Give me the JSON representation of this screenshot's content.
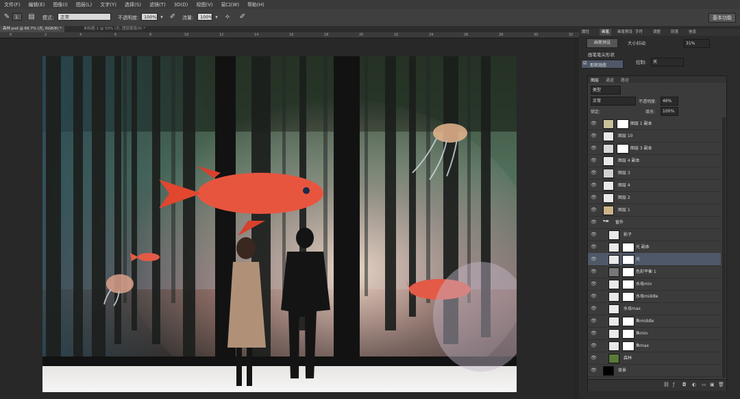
{
  "menubar": [
    "文件(F)",
    "编辑(E)",
    "图像(I)",
    "图层(L)",
    "文字(Y)",
    "选择(S)",
    "滤镜(T)",
    "3D(D)",
    "视图(V)",
    "窗口(W)",
    "帮助(H)"
  ],
  "options": {
    "mode_label": "模式:",
    "mode_value": "正常",
    "opacity_label": "不透明度:",
    "opacity_value": "100%",
    "flow_label": "流量:",
    "flow_value": "100%",
    "brush_size": "1",
    "workspace": "基本功能"
  },
  "doc_tabs": [
    {
      "label": "森林.psd @ 66.7% (光, RGB/8) *",
      "active": true
    },
    {
      "label": "未标题-1 @ 50% (光, 图层蒙版/8) *",
      "active": false
    }
  ],
  "ruler_ticks": [
    "0",
    "2",
    "4",
    "6",
    "8",
    "10",
    "12",
    "14",
    "16",
    "18",
    "20",
    "22",
    "24",
    "26",
    "28",
    "30",
    "32"
  ],
  "brush_panel": {
    "tabs": [
      "属性",
      "画笔",
      "画笔预设",
      "字符",
      "调整",
      "段落",
      "信息"
    ],
    "preset_button": "画笔预设",
    "size_jitter_label": "大小抖动",
    "size_jitter_value": "31%",
    "tip_shape_label": "画笔笔尖形状",
    "shape_dynamics_label": "形状动态",
    "control_label": "控制:",
    "control_value": "关"
  },
  "layers_panel": {
    "tabs": [
      "图层",
      "通道",
      "路径"
    ],
    "kind_value": "类型",
    "blend_value": "正常",
    "opacity_label": "不透明度:",
    "opacity_value": "46%",
    "lock_label": "锁定:",
    "fill_label": "填充:",
    "fill_value": "100%",
    "layers": [
      {
        "name": "图层 1 副本",
        "mask": true,
        "indent": false,
        "selected": false
      },
      {
        "name": "图层 10",
        "mask": false,
        "indent": false,
        "selected": false
      },
      {
        "name": "图层 3 副本",
        "mask": true,
        "indent": false,
        "selected": false
      },
      {
        "name": "图层 4 副本",
        "mask": false,
        "indent": false,
        "selected": false
      },
      {
        "name": "图层 3",
        "mask": false,
        "indent": false,
        "selected": false
      },
      {
        "name": "图层 4",
        "mask": false,
        "indent": false,
        "selected": false
      },
      {
        "name": "图层 2",
        "mask": false,
        "indent": false,
        "selected": false
      },
      {
        "name": "图层 1",
        "mask": false,
        "indent": false,
        "selected": false
      },
      {
        "name": "窗外",
        "mask": false,
        "indent": false,
        "selected": false,
        "group": true
      },
      {
        "name": "影子",
        "mask": false,
        "indent": true,
        "selected": false
      },
      {
        "name": "光 副本",
        "mask": true,
        "indent": true,
        "selected": false
      },
      {
        "name": "光",
        "mask": true,
        "indent": true,
        "selected": true
      },
      {
        "name": "色彩平衡 1",
        "mask": true,
        "indent": true,
        "selected": false,
        "adjust": true
      },
      {
        "name": "水母min",
        "mask": true,
        "indent": true,
        "selected": false
      },
      {
        "name": "水母middle",
        "mask": true,
        "indent": true,
        "selected": false
      },
      {
        "name": "水母max",
        "mask": false,
        "indent": true,
        "selected": false
      },
      {
        "name": "鱼middle",
        "mask": true,
        "indent": true,
        "selected": false
      },
      {
        "name": "鱼min",
        "mask": true,
        "indent": true,
        "selected": false
      },
      {
        "name": "鱼max",
        "mask": true,
        "indent": true,
        "selected": false
      },
      {
        "name": "森林",
        "mask": false,
        "indent": true,
        "selected": false
      },
      {
        "name": "背景",
        "mask": false,
        "indent": false,
        "selected": false,
        "bg": true
      }
    ]
  },
  "colors": {
    "fish": "#e8553f",
    "forest_dark": "#1a1f1c",
    "selection": "#4f5868"
  }
}
